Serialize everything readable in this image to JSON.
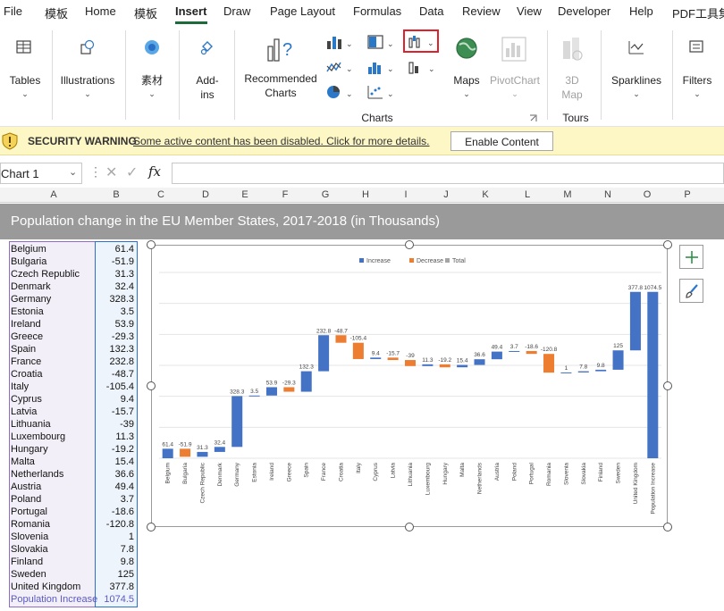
{
  "menu": [
    "File",
    "模板",
    "Home",
    "模板",
    "Insert",
    "Draw",
    "Page Layout",
    "Formulas",
    "Data",
    "Review",
    "View",
    "Developer",
    "Help",
    "PDF工具集"
  ],
  "ribbon": {
    "tables": "Tables",
    "illustrations": "Illustrations",
    "sucai": "素材",
    "addins_1": "Add-",
    "addins_2": "ins",
    "recommended_1": "Recommended",
    "recommended_2": "Charts",
    "maps": "Maps",
    "pivotchart": "PivotChart",
    "map3d_1": "3D",
    "map3d_2": "Map",
    "sparklines": "Sparklines",
    "filters": "Filters",
    "group_charts": "Charts",
    "group_tours": "Tours"
  },
  "warning": {
    "label": "SECURITY WARNING",
    "message": "Some active content has been disabled. Click for more details.",
    "button": "Enable Content"
  },
  "formula": {
    "namebox": "Chart 1",
    "fx": "fx"
  },
  "columns": [
    "A",
    "B",
    "C",
    "D",
    "E",
    "F",
    "G",
    "H",
    "I",
    "J",
    "K",
    "L",
    "M",
    "N",
    "O",
    "P"
  ],
  "sheet_title": "Population change in the EU Member States, 2017-2018 (in Thousands)",
  "rows": [
    {
      "country": "Belgium",
      "value": "61.4"
    },
    {
      "country": "Bulgaria",
      "value": "-51.9"
    },
    {
      "country": "Czech Republic",
      "value": "31.3"
    },
    {
      "country": "Denmark",
      "value": "32.4"
    },
    {
      "country": "Germany",
      "value": "328.3"
    },
    {
      "country": "Estonia",
      "value": "3.5"
    },
    {
      "country": "Ireland",
      "value": "53.9"
    },
    {
      "country": "Greece",
      "value": "-29.3"
    },
    {
      "country": "Spain",
      "value": "132.3"
    },
    {
      "country": "France",
      "value": "232.8"
    },
    {
      "country": "Croatia",
      "value": "-48.7"
    },
    {
      "country": "Italy",
      "value": "-105.4"
    },
    {
      "country": "Cyprus",
      "value": "9.4"
    },
    {
      "country": "Latvia",
      "value": "-15.7"
    },
    {
      "country": "Lithuania",
      "value": "-39"
    },
    {
      "country": "Luxembourg",
      "value": "11.3"
    },
    {
      "country": "Hungary",
      "value": "-19.2"
    },
    {
      "country": "Malta",
      "value": "15.4"
    },
    {
      "country": "Netherlands",
      "value": "36.6"
    },
    {
      "country": "Austria",
      "value": "49.4"
    },
    {
      "country": "Poland",
      "value": "3.7"
    },
    {
      "country": "Portugal",
      "value": "-18.6"
    },
    {
      "country": "Romania",
      "value": "-120.8"
    },
    {
      "country": "Slovenia",
      "value": "1"
    },
    {
      "country": "Slovakia",
      "value": "7.8"
    },
    {
      "country": "Finland",
      "value": "9.8"
    },
    {
      "country": "Sweden",
      "value": "125"
    },
    {
      "country": "United Kingdom",
      "value": "377.8"
    },
    {
      "country": "Population Increase",
      "value": "1074.5"
    }
  ],
  "chart_data": {
    "type": "bar",
    "subtype": "waterfall",
    "legend": [
      "Increase",
      "Decrease",
      "Total"
    ],
    "legend_position": "top",
    "colors": {
      "increase": "#4472c4",
      "decrease": "#ed7d31",
      "total": "#a5a5a5"
    },
    "categories": [
      "Belgium",
      "Bulgaria",
      "Czech Republic",
      "Denmark",
      "Germany",
      "Estonia",
      "Ireland",
      "Greece",
      "Spain",
      "France",
      "Croatia",
      "Italy",
      "Cyprus",
      "Latvia",
      "Lithuania",
      "Luxembourg",
      "Hungary",
      "Malta",
      "Netherlands",
      "Austria",
      "Poland",
      "Portugal",
      "Romania",
      "Slovenia",
      "Slovakia",
      "Finland",
      "Sweden",
      "United Kingdom",
      "Population Increase"
    ],
    "values": [
      61.4,
      -51.9,
      31.3,
      32.4,
      328.3,
      3.5,
      53.9,
      -29.3,
      132.3,
      232.8,
      -48.7,
      -105.4,
      9.4,
      -15.7,
      -39,
      11.3,
      -19.2,
      15.4,
      36.6,
      49.4,
      3.7,
      -18.6,
      -120.8,
      1,
      7.8,
      9.8,
      125,
      377.8,
      1074.5
    ],
    "data_labels": [
      "61.4",
      "-51.9",
      "31.3",
      "32.4",
      "328.3",
      "3.5",
      "53.9",
      "-29.3",
      "132.3",
      "232.8",
      "-48.7",
      "-105.4",
      "9.4",
      "-15.7",
      "-39",
      "11.3",
      "-19.2",
      "15.4",
      "36.6",
      "49.4",
      "3.7",
      "-18.6",
      "-120.8",
      "1",
      "7.8",
      "9.8",
      "125",
      "377.8",
      "1074.5"
    ],
    "ylim": [
      0,
      1200
    ],
    "grid": true
  }
}
